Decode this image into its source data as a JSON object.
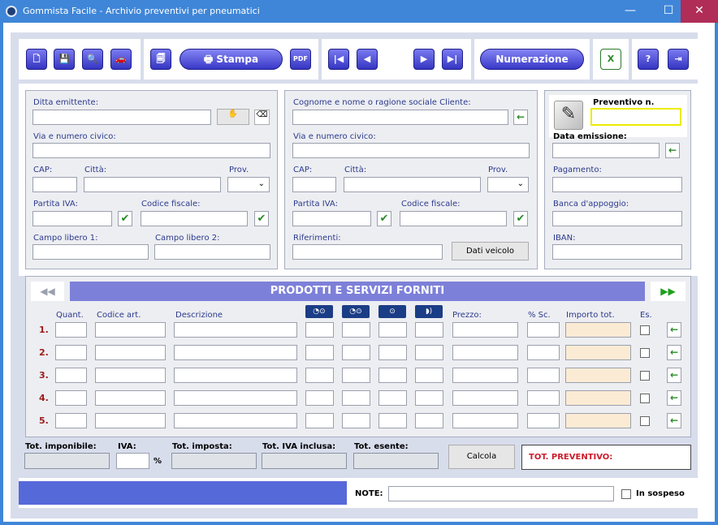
{
  "window": {
    "title": "Gommista Facile - Archivio preventivi per pneumatici",
    "min": "—",
    "max": "☐",
    "close": "✕"
  },
  "toolbar": {
    "new": "🗋",
    "save": "💾",
    "search": "🔍",
    "car": "🚗",
    "preview": "🗐",
    "print": "Stampa",
    "pdf": "PDF",
    "first": "|◀",
    "prev": "◀",
    "next": "▶",
    "last": "▶|",
    "numbering": "Numerazione",
    "excel": "X",
    "help": "?",
    "exit": "⇥"
  },
  "company": {
    "ditta_label": "Ditta emittente:",
    "via_label": "Via e numero civico:",
    "cap_label": "CAP:",
    "citta_label": "Città:",
    "prov_label": "Prov.",
    "piva_label": "Partita IVA:",
    "cf_label": "Codice fiscale:",
    "campo1_label": "Campo libero 1:",
    "campo2_label": "Campo libero 2:"
  },
  "client": {
    "nome_label": "Cognome e nome o ragione sociale Cliente:",
    "via_label": "Via e numero civico:",
    "cap_label": "CAP:",
    "citta_label": "Città:",
    "prov_label": "Prov.",
    "piva_label": "Partita IVA:",
    "cf_label": "Codice fiscale:",
    "rif_label": "Riferimenti:",
    "vehicle_button": "Dati veicolo"
  },
  "quote": {
    "num_label": "Preventivo n.",
    "date_label": "Data emissione:",
    "pay_label": "Pagamento:",
    "bank_label": "Banca d'appoggio:",
    "iban_label": "IBAN:"
  },
  "products": {
    "title": "PRODOTTI E SERVIZI FORNITI",
    "prev": "◀◀",
    "next": "▶▶",
    "cols": {
      "qty": "Quant.",
      "code": "Codice art.",
      "desc": "Descrizione",
      "price": "Prezzo:",
      "disc": "% Sc.",
      "total": "Importo tot.",
      "ex": "Es."
    },
    "rows": [
      "1.",
      "2.",
      "3.",
      "4.",
      "5."
    ]
  },
  "totals": {
    "imponibile": "Tot. imponibile:",
    "iva": "IVA:",
    "percent": "%",
    "imposta": "Tot. imposta:",
    "ivainclusa": "Tot. IVA inclusa:",
    "esente": "Tot. esente:",
    "calc": "Calcola",
    "preventivo": "TOT. PREVENTIVO:"
  },
  "footer": {
    "note": "NOTE:",
    "sospeso": "In sospeso"
  },
  "common": {
    "check": "✔",
    "arrow": "←",
    "chevron": "⌄"
  }
}
